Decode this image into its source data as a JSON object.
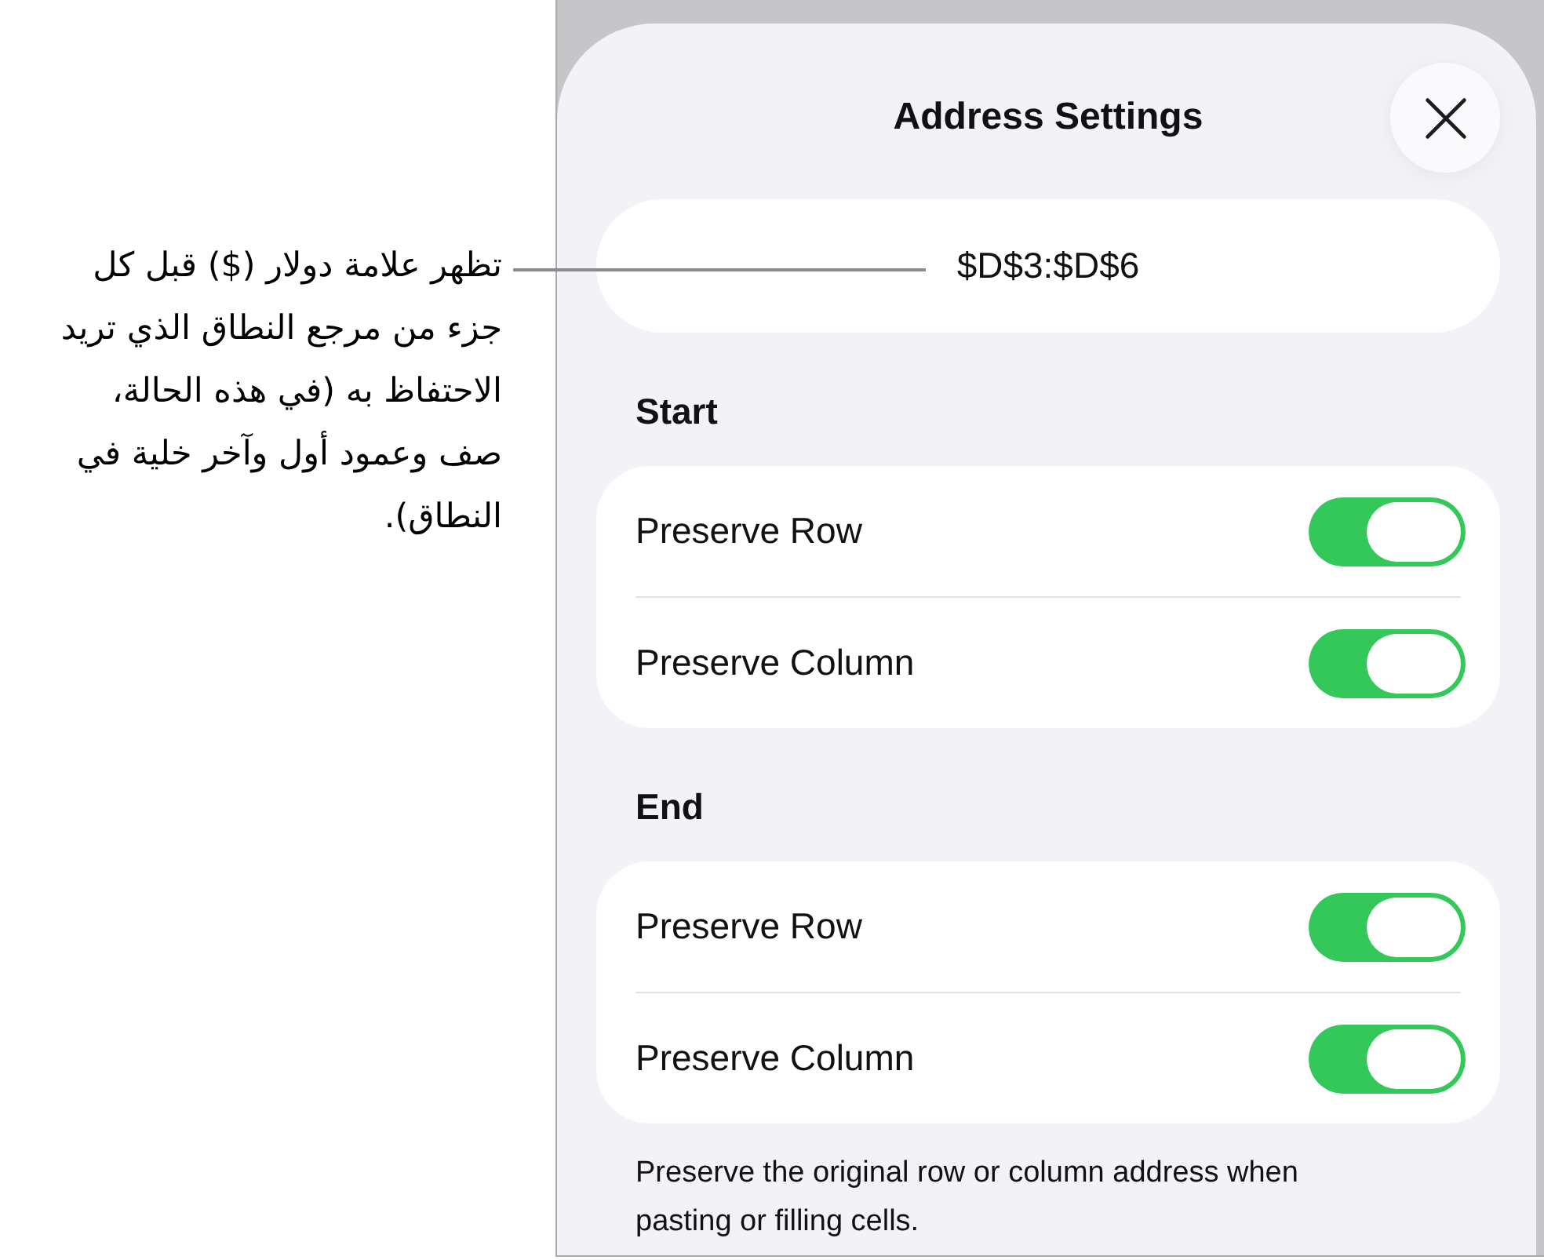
{
  "callout": {
    "text": "تظهر علامة دولار ($) قبل كل جزء من مرجع النطاق الذي تريد الاحتفاظ به (في هذه الحالة، صف وعمود أول وآخر خلية في النطاق)."
  },
  "sheet": {
    "title": "Address Settings",
    "address": {
      "value": "$D$3:$D$6"
    },
    "sections": [
      {
        "heading": "Start",
        "toggles": [
          {
            "label": "Preserve Row",
            "on": true
          },
          {
            "label": "Preserve Column",
            "on": true
          }
        ]
      },
      {
        "heading": "End",
        "toggles": [
          {
            "label": "Preserve Row",
            "on": true
          },
          {
            "label": "Preserve Column",
            "on": true
          }
        ]
      }
    ],
    "footnote": "Preserve the original row or column address when pasting or filling cells."
  }
}
